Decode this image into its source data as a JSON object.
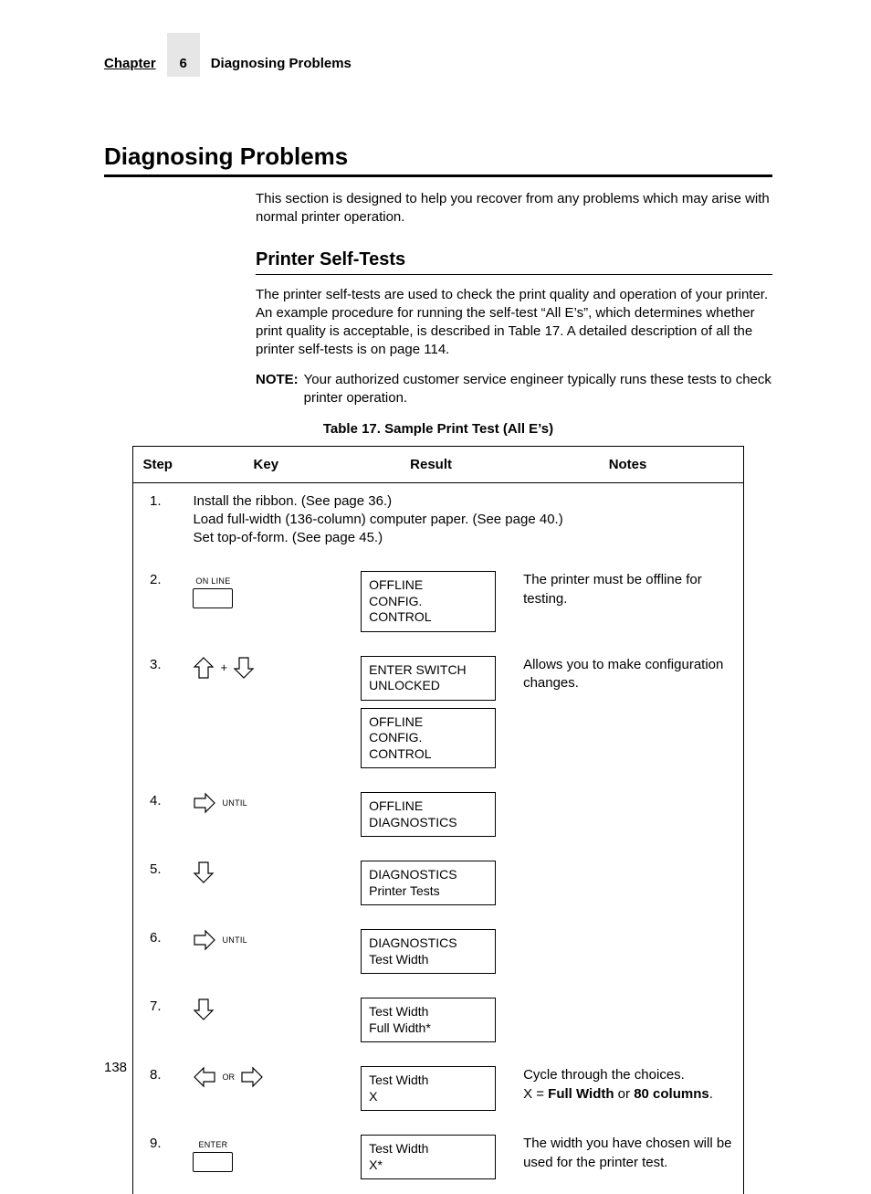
{
  "header": {
    "chapter_label": "Chapter",
    "chapter_num": "6",
    "section": "Diagnosing Problems"
  },
  "h1": "Diagnosing Problems",
  "intro": "This section is designed to help you recover from any problems which may arise with normal printer operation.",
  "h2": "Printer Self-Tests",
  "body": "The printer self-tests are used to check the print quality and operation of your printer. An example procedure for running the self-test “All E’s”, which determines whether print quality is acceptable, is described in Table 17. A detailed description of all the printer self-tests is on page 114.",
  "note_label": "NOTE:",
  "note_body": "Your authorized customer service engineer typically runs these tests to check printer operation.",
  "table_caption": "Table 17. Sample Print Test (All E’s)",
  "th": {
    "step": "Step",
    "key": "Key",
    "result": "Result",
    "notes": "Notes"
  },
  "rows": {
    "r1": {
      "num": "1.",
      "text_l1": "Install the ribbon. (See page 36.)",
      "text_l2": "Load full-width (136-column) computer paper. (See page 40.)",
      "text_l3": "Set top-of-form. (See page 45.)"
    },
    "r2": {
      "num": "2.",
      "key_label": "ON LINE",
      "res_l1": "OFFLINE",
      "res_l2": "CONFIG. CONTROL",
      "note": "The printer must be offline for testing."
    },
    "r3": {
      "num": "3.",
      "plus": "+",
      "res1_l1": "ENTER SWITCH",
      "res1_l2": "UNLOCKED",
      "res2_l1": "OFFLINE",
      "res2_l2": "CONFIG. CONTROL",
      "note": "Allows you to make configuration changes."
    },
    "r4": {
      "num": "4.",
      "until": "UNTIL",
      "res_l1": "OFFLINE",
      "res_l2": "DIAGNOSTICS"
    },
    "r5": {
      "num": "5.",
      "res_l1": "DIAGNOSTICS",
      "res_l2": "Printer Tests"
    },
    "r6": {
      "num": "6.",
      "until": "UNTIL",
      "res_l1": "DIAGNOSTICS",
      "res_l2": "Test Width"
    },
    "r7": {
      "num": "7.",
      "res_l1": "Test Width",
      "res_l2": "Full Width*"
    },
    "r8": {
      "num": "8.",
      "or": "OR",
      "res_l1": "Test Width",
      "res_l2": "X",
      "note_pre": "Cycle through the choices.",
      "note_x": "X = ",
      "note_b1": "Full Width",
      "note_or": " or ",
      "note_b2": "80 columns",
      "note_end": "."
    },
    "r9": {
      "num": "9.",
      "enter": "ENTER",
      "res_l1": "Test Width",
      "res_l2": "X*",
      "note": "The width you have chosen will be used for the printer test."
    }
  },
  "page_num": "138"
}
